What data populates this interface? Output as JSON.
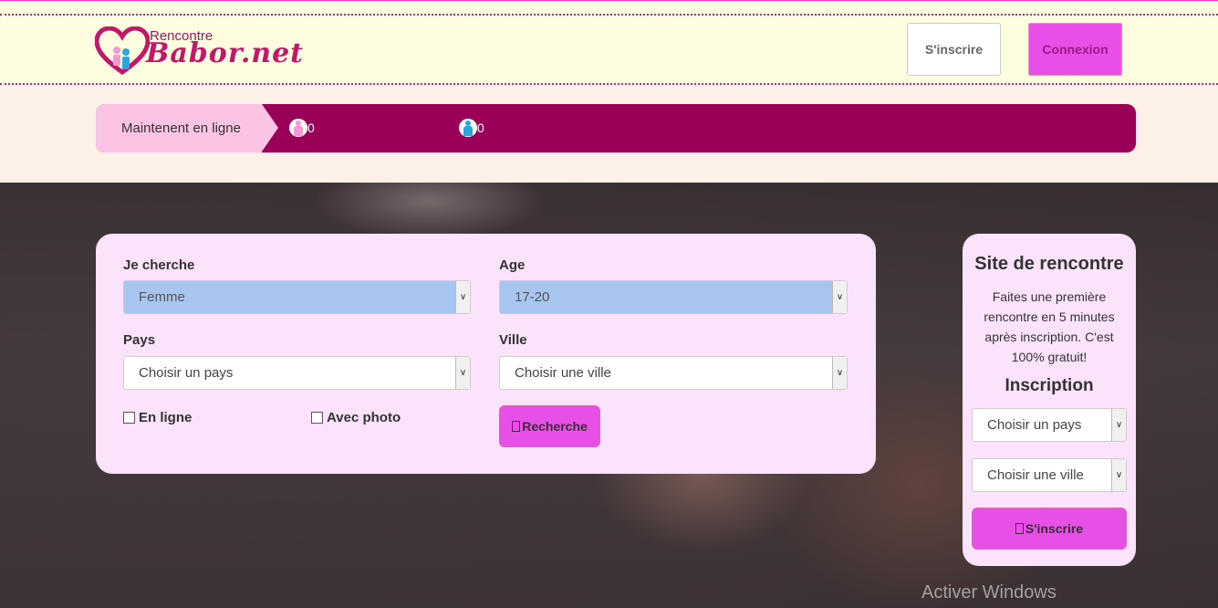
{
  "header": {
    "logo_small": "Rencontre",
    "logo_big": "Babor.net",
    "signup_label": "S'inscrire",
    "login_label": "Connexion"
  },
  "online": {
    "label": "Maintenent en ligne",
    "female_count": "0",
    "male_count": "0"
  },
  "search": {
    "looking_for_label": "Je cherche",
    "looking_for_value": "Femme",
    "age_label": "Age",
    "age_value": "17-20",
    "country_label": "Pays",
    "country_value": "Choisir un pays",
    "city_label": "Ville",
    "city_value": "Choisir une ville",
    "online_checkbox_label": "En ligne",
    "photo_checkbox_label": "Avec photo",
    "search_button_label": "Recherche"
  },
  "signup": {
    "title": "Site de rencontre",
    "description": "Faites une première rencontre en 5 minutes après inscription. C'est 100% gratuit!",
    "subtitle": "Inscription",
    "country_value": "Choisir un pays",
    "city_value": "Choisir une ville",
    "button_label": "S'inscrire"
  },
  "watermark": "Activer Windows",
  "colors": {
    "accent": "#e84fe6",
    "online_bar": "#9b0058",
    "panel_bg": "#fbe3fc",
    "header_bg": "#fffde0"
  }
}
